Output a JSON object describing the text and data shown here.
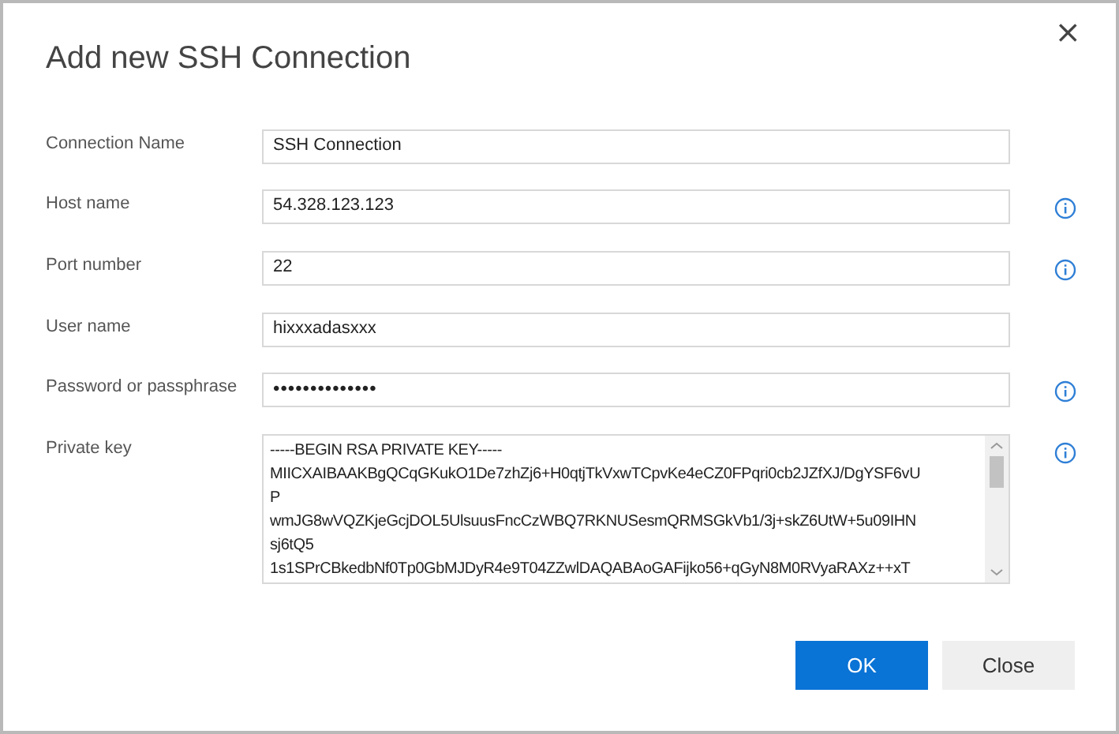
{
  "dialog": {
    "title": "Add new SSH Connection",
    "close_label": "×"
  },
  "fields": [
    {
      "label": "Connection Name",
      "value": "SSH Connection",
      "info": false
    },
    {
      "label": "Host name",
      "value": "54.328.123.123",
      "info": true
    },
    {
      "label": "Port number",
      "value": "22",
      "info": true
    },
    {
      "label": "User name",
      "value": "hixxxadasxxx",
      "info": false
    },
    {
      "label": "Password or passphrase",
      "value": "••••••••••••••",
      "info": true
    }
  ],
  "private_key": {
    "label": "Private key",
    "info": true,
    "lines": [
      "-----BEGIN RSA PRIVATE KEY-----",
      "MIICXAIBAAKBgQCqGKukO1De7zhZj6+H0qtjTkVxwTCpvKe4eCZ0FPqri0cb2JZfXJ/DgYSF6vU",
      "P",
      "wmJG8wVQZKjeGcjDOL5UlsuusFncCzWBQ7RKNUSesmQRMSGkVb1/3j+skZ6UtW+5u09IHN",
      "sj6tQ5",
      "1s1SPrCBkedbNf0Tp0GbMJDyR4e9T04ZZwlDAQABAoGAFijko56+qGyN8M0RVyaRAXz++xT"
    ]
  },
  "buttons": [
    {
      "label": "OK",
      "kind": "primary"
    },
    {
      "label": "Close",
      "kind": "secondary"
    }
  ]
}
